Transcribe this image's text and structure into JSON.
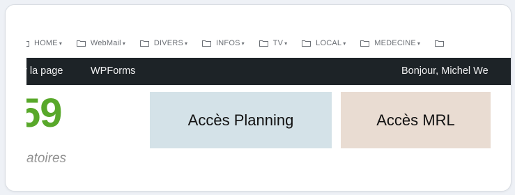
{
  "bookmarks": [
    {
      "label": "HOME",
      "icon": "folder-icon"
    },
    {
      "label": "WebMail",
      "icon": "folder-icon"
    },
    {
      "label": "DIVERS",
      "icon": "folder-icon"
    },
    {
      "label": "INFOS",
      "icon": "folder-icon"
    },
    {
      "label": "TV",
      "icon": "folder-icon"
    },
    {
      "label": "LOCAL",
      "icon": "folder-icon"
    },
    {
      "label": "MEDECINE",
      "icon": "folder-icon"
    }
  ],
  "admin_bar": {
    "edit_page": "r la page",
    "wpforms": "WPForms",
    "greeting": "Bonjour, Michel We"
  },
  "content": {
    "big_number": "59",
    "subword": "atoires",
    "tile_planning": "Accès Planning",
    "tile_mrl": "Accès MRL"
  },
  "colors": {
    "admin_bar_bg": "#1d2327",
    "number_green": "#58a82a",
    "tile_planning_bg": "#d4e2e8",
    "tile_mrl_bg": "#e9dcd2"
  }
}
